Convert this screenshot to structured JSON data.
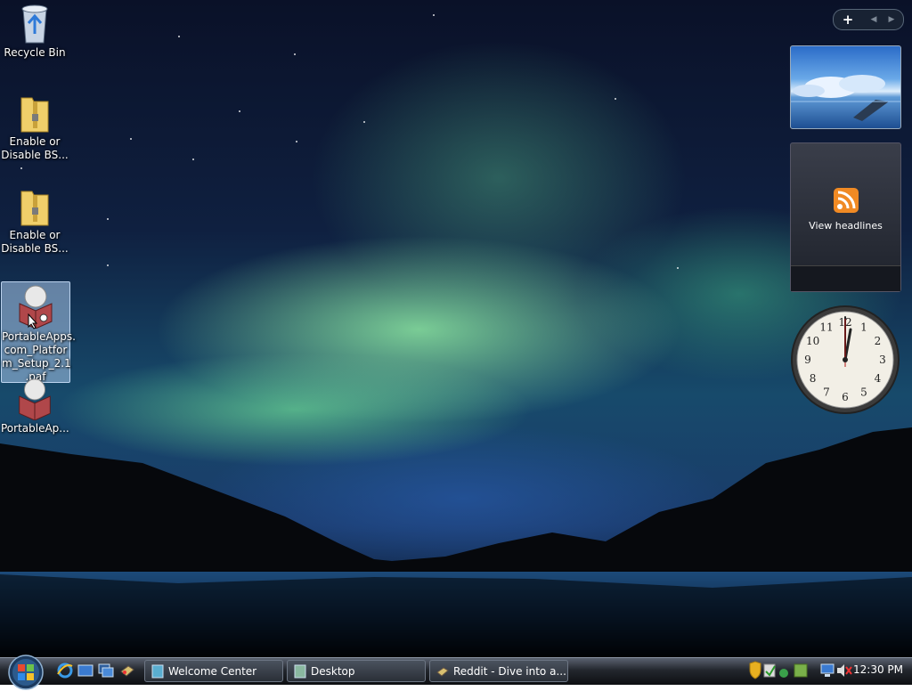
{
  "desktop": {
    "icons": [
      {
        "label": "Recycle Bin",
        "icon": "recycle-bin-icon"
      },
      {
        "label": "Enable or\nDisable BS...",
        "icon": "zip-folder-icon"
      },
      {
        "label": "Enable or\nDisable BS...",
        "icon": "zip-folder-icon"
      },
      {
        "label": "PortableApps.\ncom_Platfor\nm_Setup_2.1\n.paf",
        "icon": "portableapps-package-icon",
        "selected": true
      },
      {
        "label": "PortableAp...",
        "icon": "portableapps-package-icon"
      }
    ]
  },
  "sidebar": {
    "add_label": "+",
    "prev_label": "◀",
    "next_label": "▶",
    "feed_headlines_label": "View headlines",
    "clock_hour_labels": [
      "12",
      "1",
      "2",
      "3",
      "4",
      "5",
      "6",
      "7",
      "8",
      "9",
      "10",
      "11"
    ]
  },
  "taskbar": {
    "quick_launch": [
      "internet-explorer-icon",
      "show-desktop-icon",
      "switch-windows-icon",
      "paint-icon"
    ],
    "buttons": [
      {
        "label": "Welcome Center",
        "icon": "welcome-center-icon"
      },
      {
        "label": "Desktop",
        "icon": "folder-window-icon"
      },
      {
        "label": "Reddit - Dive into a...",
        "icon": "paint-icon"
      }
    ],
    "tray_icons": [
      "security-shield-icon",
      "windows-defender-icon",
      "network-icon",
      "power-icon",
      "display-icon",
      "volume-muted-icon"
    ],
    "time": "12:30 PM"
  },
  "colors": {
    "aurora": "#8ce6a0",
    "taskbar": "#23272e",
    "selection": "#aac8eb"
  }
}
